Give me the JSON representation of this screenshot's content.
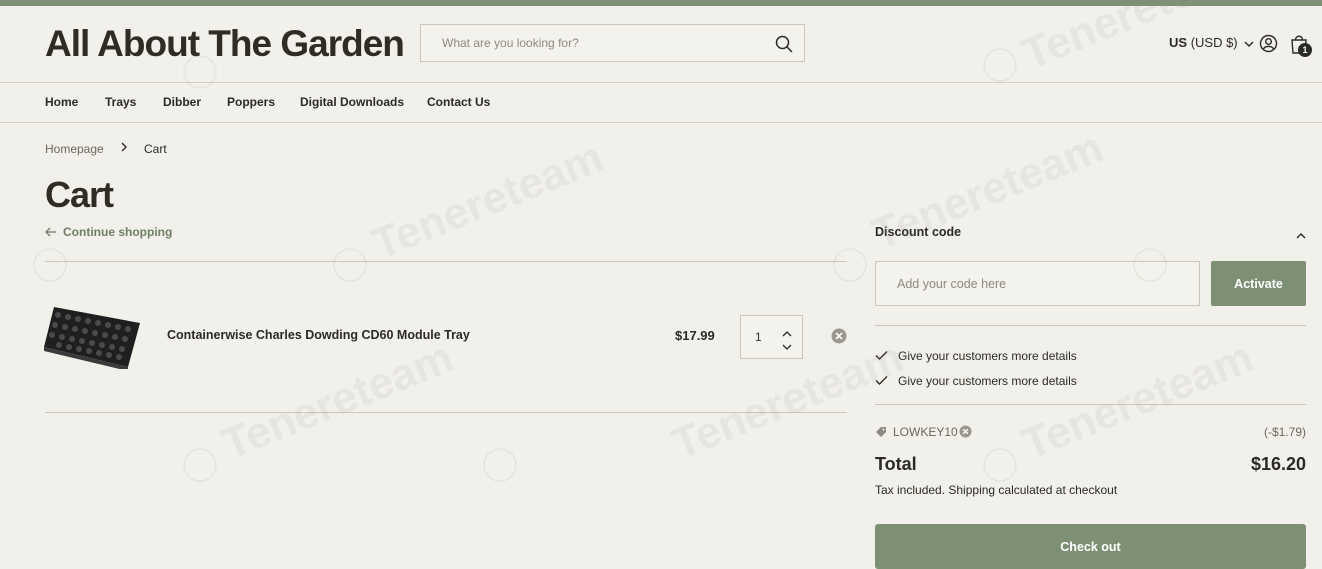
{
  "store": {
    "name": "All About The Garden"
  },
  "search": {
    "placeholder": "What are you looking for?"
  },
  "header": {
    "currency_code": "US",
    "currency_label": "(USD $)",
    "cart_count": "1"
  },
  "nav": {
    "items": [
      {
        "label": "Home"
      },
      {
        "label": "Trays"
      },
      {
        "label": "Dibber"
      },
      {
        "label": "Poppers"
      },
      {
        "label": "Digital Downloads"
      },
      {
        "label": "Contact Us"
      }
    ]
  },
  "breadcrumb": {
    "home": "Homepage",
    "separator": ">",
    "current": "Cart"
  },
  "page": {
    "title": "Cart",
    "continue_label": "Continue shopping"
  },
  "cart": {
    "items": [
      {
        "name": "Containerwise Charles Dowding CD60 Module Tray",
        "price": "$17.99",
        "quantity": "1"
      }
    ]
  },
  "discount": {
    "title": "Discount code",
    "placeholder": "Add your code here",
    "button_label": "Activate",
    "details": [
      "Give your customers more details",
      "Give your customers more details"
    ],
    "applied_code": "LOWKEY10",
    "applied_amount": "(-$1.79)"
  },
  "summary": {
    "total_label": "Total",
    "total_value": "$16.20",
    "tax_note": "Tax included. Shipping calculated at checkout",
    "checkout_label": "Check out"
  },
  "watermark": {
    "text": "Tenereteam"
  },
  "colors": {
    "accent": "#7e9074",
    "background": "#f2f0ea",
    "text": "#2c2a24"
  }
}
